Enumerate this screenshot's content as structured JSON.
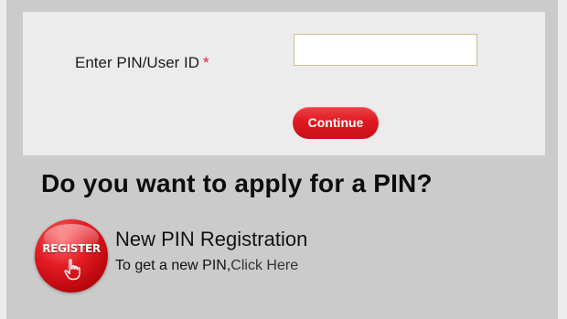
{
  "login": {
    "field_label": "Enter PIN/User ID",
    "required_marker": "*",
    "input_value": "",
    "continue_label": "Continue"
  },
  "apply": {
    "heading": "Do you want to apply for a PIN?",
    "badge_text": "REGISTER",
    "badge_icon": "hand-pointer-icon",
    "title": "New PIN Registration",
    "description_prefix": "To get a new PIN,",
    "link_text": "Click Here"
  },
  "colors": {
    "accent_red": "#e01820",
    "required_red": "#d8202a",
    "panel_gray": "#cbcbcb",
    "box_light": "#ececec",
    "input_border": "#cdbf93"
  }
}
